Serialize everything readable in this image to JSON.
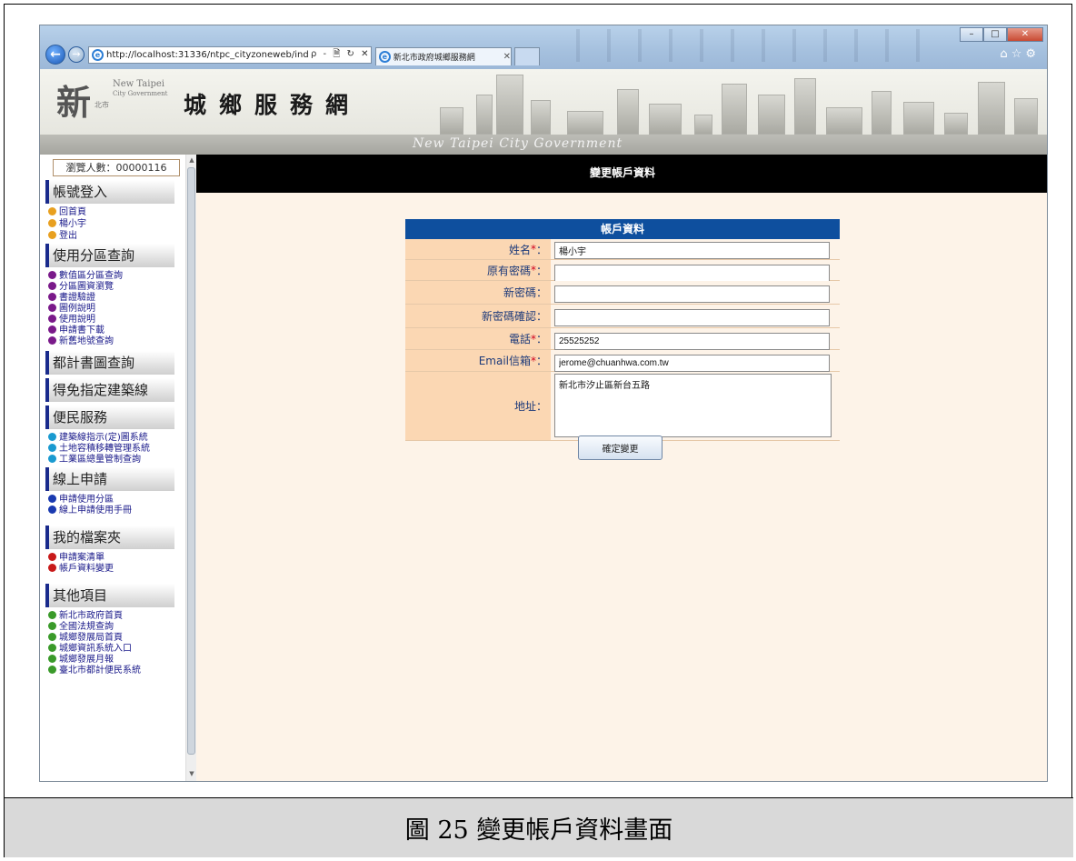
{
  "browser": {
    "url": "http://localhost:31336/ntpc_cityzoneweb/ind",
    "address_tools": "ρ - 🗎 ↻ ✕",
    "tab_title": "新北市政府城鄉服務網",
    "tab_close": "✕",
    "window_buttons": [
      "–",
      "□",
      "✕"
    ],
    "toolbar_icons": [
      "home-icon",
      "star-icon",
      "gear-icon"
    ]
  },
  "header": {
    "logo_char": "新",
    "logo_sub": "北市",
    "logo_en_1": "New Taipei",
    "logo_en_2": "City Government",
    "site_title": "城鄉服務網",
    "subtitle": "New Taipei City Government"
  },
  "sidebar": {
    "counter": "瀏覽人數：00000116",
    "sections": [
      {
        "title": "帳號登入",
        "items": [
          {
            "label": "回首頁",
            "color": "#e8a020"
          },
          {
            "label": "楊小宇",
            "color": "#e8a020"
          },
          {
            "label": "登出",
            "color": "#e8a020"
          }
        ]
      },
      {
        "title": "使用分區查詢",
        "items": [
          {
            "label": "數值區分區查詢",
            "color": "#7a1a8a"
          },
          {
            "label": "分區圖資瀏覽",
            "color": "#7a1a8a"
          },
          {
            "label": "書證驗證",
            "color": "#7a1a8a"
          },
          {
            "label": "圖例說明",
            "color": "#7a1a8a"
          },
          {
            "label": "使用說明",
            "color": "#7a1a8a"
          },
          {
            "label": "申請書下載",
            "color": "#7a1a8a"
          },
          {
            "label": "新舊地號查詢",
            "color": "#7a1a8a"
          }
        ]
      },
      {
        "title": "都計書圖查詢",
        "items": []
      },
      {
        "title": "得免指定建築線",
        "items": []
      },
      {
        "title": "便民服務",
        "items": [
          {
            "label": "建築線指示(定)圖系統",
            "color": "#1a9ad0"
          },
          {
            "label": "土地容積移轉管理系統",
            "color": "#1a9ad0"
          },
          {
            "label": "工業區總量管制查詢",
            "color": "#1a9ad0"
          }
        ]
      },
      {
        "title": "線上申請",
        "items": [
          {
            "label": "申請使用分區",
            "color": "#1a3ab0"
          },
          {
            "label": "線上申請使用手冊",
            "color": "#1a3ab0"
          }
        ]
      },
      {
        "title": "我的檔案夾",
        "items": [
          {
            "label": "申請案清單",
            "color": "#c81a1a"
          },
          {
            "label": "帳戶資料變更",
            "color": "#c81a1a"
          }
        ]
      },
      {
        "title": "其他項目",
        "items": [
          {
            "label": "新北市政府首頁",
            "color": "#3a9a2a"
          },
          {
            "label": "全國法規查詢",
            "color": "#3a9a2a"
          },
          {
            "label": "城鄉發展局首頁",
            "color": "#3a9a2a"
          },
          {
            "label": "城鄉資訊系統入口",
            "color": "#3a9a2a"
          },
          {
            "label": "城鄉發展月報",
            "color": "#3a9a2a"
          },
          {
            "label": "臺北市都計便民系統",
            "color": "#3a9a2a"
          }
        ]
      }
    ]
  },
  "content": {
    "page_header": "變更帳戶資料",
    "form_title": "帳戶資料",
    "fields": {
      "name": {
        "label": "姓名",
        "required": "*",
        "colon": "：",
        "value": "楊小宇"
      },
      "old_password": {
        "label": "原有密碼",
        "required": "*",
        "colon": "：",
        "value": ""
      },
      "new_password": {
        "label": "新密碼",
        "colon": "：",
        "value": ""
      },
      "confirm_password": {
        "label": "新密碼確認",
        "colon": "：",
        "value": ""
      },
      "phone": {
        "label": "電話",
        "required": "*",
        "colon": "：",
        "value": "25525252"
      },
      "email": {
        "label": "Email信箱",
        "required": "*",
        "colon": "：",
        "value": "jerome@chuanhwa.com.tw"
      },
      "address": {
        "label": "地址",
        "colon": "：",
        "value": "新北市汐止區新台五路"
      }
    },
    "submit_label": "確定變更"
  },
  "caption": "圖 25  變更帳戶資料畫面"
}
